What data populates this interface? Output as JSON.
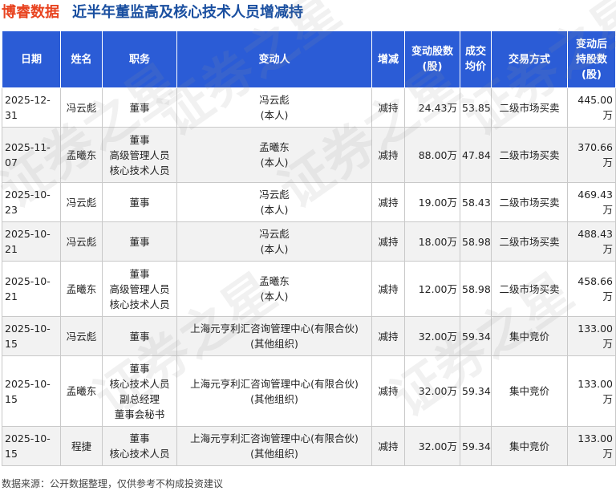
{
  "brand": "博睿数据",
  "title": "近半年董监高及核心技术人员增减持",
  "headers": [
    "日期",
    "姓名",
    "职务",
    "变动人",
    "增减",
    "变动股数\n(股)",
    "成交\n均价",
    "交易方式",
    "变动后\n持股数\n(股)"
  ],
  "rows": [
    {
      "date": "2025-12-31",
      "name": "冯云彪",
      "position": "董事",
      "person": "冯云彪\n(本人)",
      "change": "减持",
      "shares": "24.43万",
      "price": "53.85",
      "method": "二级市场买卖",
      "after": "445.00万"
    },
    {
      "date": "2025-11-07",
      "name": "孟曦东",
      "position": "董事\n高级管理人员\n核心技术人员",
      "person": "孟曦东\n(本人)",
      "change": "减持",
      "shares": "88.00万",
      "price": "47.84",
      "method": "二级市场买卖",
      "after": "370.66万"
    },
    {
      "date": "2025-10-23",
      "name": "冯云彪",
      "position": "董事",
      "person": "冯云彪\n(本人)",
      "change": "减持",
      "shares": "19.00万",
      "price": "58.43",
      "method": "二级市场买卖",
      "after": "469.43万"
    },
    {
      "date": "2025-10-21",
      "name": "冯云彪",
      "position": "董事",
      "person": "冯云彪\n(本人)",
      "change": "减持",
      "shares": "18.00万",
      "price": "58.98",
      "method": "二级市场买卖",
      "after": "488.43万"
    },
    {
      "date": "2025-10-21",
      "name": "孟曦东",
      "position": "董事\n高级管理人员\n核心技术人员",
      "person": "孟曦东\n(本人)",
      "change": "减持",
      "shares": "12.00万",
      "price": "58.98",
      "method": "二级市场买卖",
      "after": "458.66万"
    },
    {
      "date": "2025-10-15",
      "name": "冯云彪",
      "position": "董事",
      "person": "上海元亨利汇咨询管理中心(有限合伙)\n(其他组织)",
      "change": "减持",
      "shares": "32.00万",
      "price": "59.34",
      "method": "集中竞价",
      "after": "133.00万"
    },
    {
      "date": "2025-10-15",
      "name": "孟曦东",
      "position": "董事\n核心技术人员\n副总经理\n董事会秘书",
      "person": "上海元亨利汇咨询管理中心(有限合伙)\n(其他组织)",
      "change": "减持",
      "shares": "32.00万",
      "price": "59.34",
      "method": "集中竞价",
      "after": "133.00万"
    },
    {
      "date": "2025-10-15",
      "name": "程捷",
      "position": "董事\n核心技术人员",
      "person": "上海元亨利汇咨询管理中心(有限合伙)\n(其他组织)",
      "change": "减持",
      "shares": "32.00万",
      "price": "59.34",
      "method": "集中竞价",
      "after": "133.00万"
    }
  ],
  "source": "数据来源：公开数据整理，仅供参考不构成投资建议",
  "watermark": "证券之星",
  "colors": {
    "header_bg": "#2b5cd6",
    "decrease_text": "#1b9a3c",
    "brand": "#e8431f",
    "title": "#1a4fa0"
  }
}
